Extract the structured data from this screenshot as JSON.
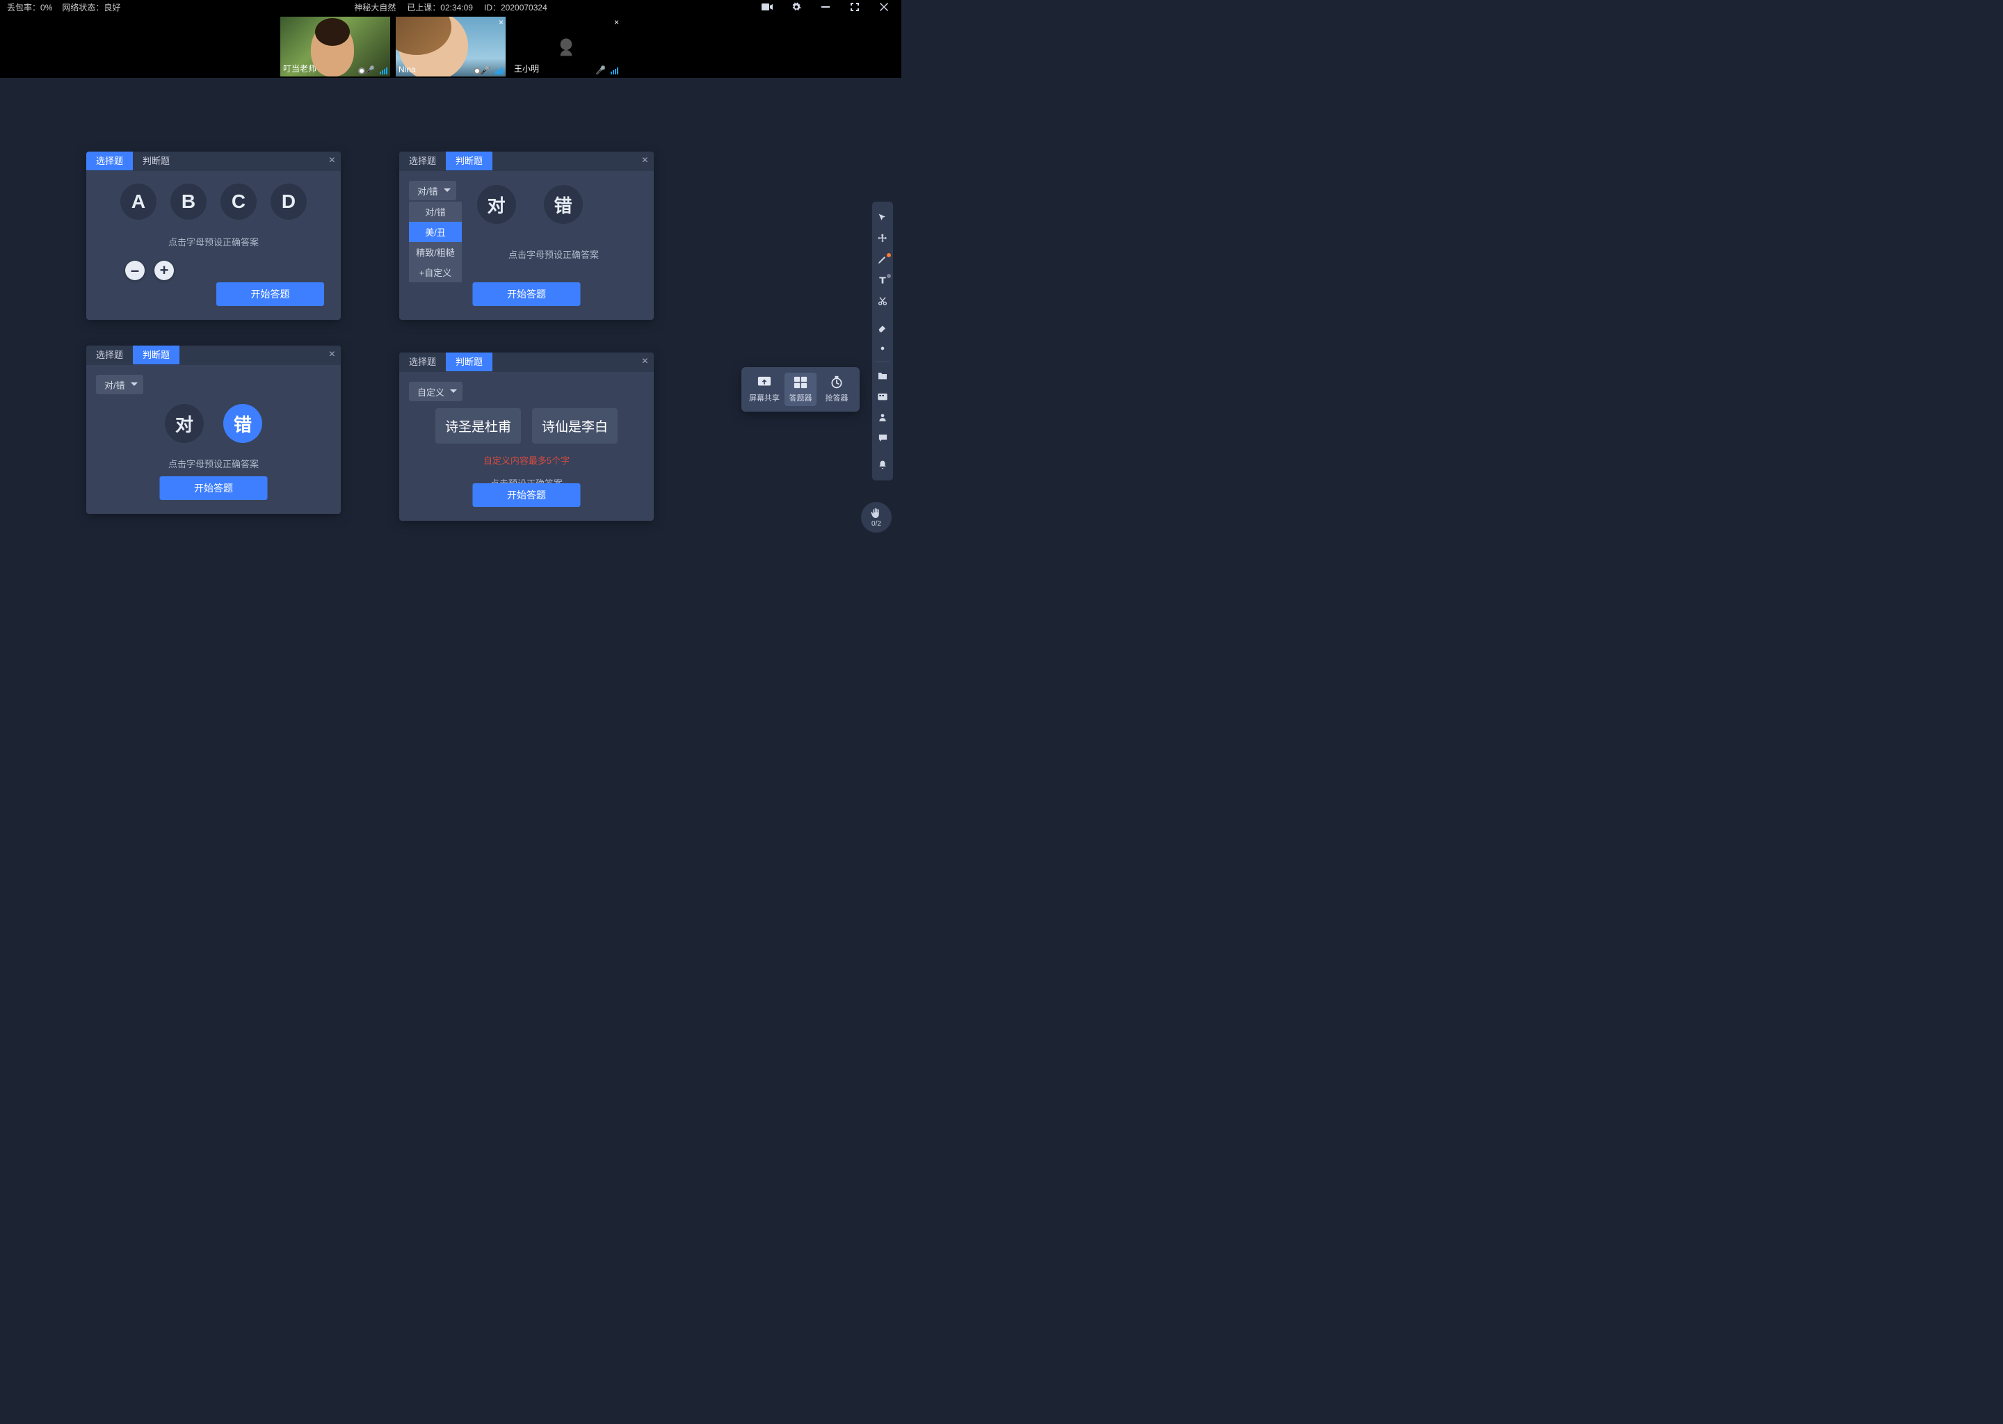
{
  "topbar": {
    "loss_label": "丢包率：",
    "loss_val": "0%",
    "net_label": "网络状态：",
    "net_val": "良好",
    "title": "神秘大自然",
    "status_label": "已上课：",
    "status_val": "02:34:09",
    "id_label": "ID：",
    "id_val": "2020070324"
  },
  "participants": [
    {
      "name": "叮当老师",
      "cam": true,
      "mic": true,
      "closeable": false
    },
    {
      "name": "Nina",
      "cam": true,
      "mic": true,
      "closeable": true
    },
    {
      "name": "王小明",
      "cam": false,
      "mic": false,
      "closeable": true
    }
  ],
  "common": {
    "tab_choice": "选择题",
    "tab_judge": "判断题",
    "preset_hint": "点击字母预设正确答案",
    "preset_hint2": "点击预设正确答案",
    "start": "开始答题",
    "minus": "–",
    "plus": "+"
  },
  "panel1": {
    "opts": [
      "A",
      "B",
      "C",
      "D"
    ]
  },
  "panel2": {
    "dd_sel": "对/错",
    "opts": [
      "对",
      "错"
    ],
    "menu": [
      "对/错",
      "美/丑",
      "精致/粗糙",
      "+自定义"
    ],
    "menu_sel": 1
  },
  "panel3": {
    "dd_sel": "对/错",
    "opts": [
      "对",
      "错"
    ],
    "sel": 1
  },
  "panel4": {
    "dd_sel": "自定义",
    "pills": [
      "诗圣是杜甫",
      "诗仙是李白"
    ],
    "err": "自定义内容最多5个字"
  },
  "tools": {
    "share": "屏幕共享",
    "answer": "答题器",
    "race": "抢答器"
  },
  "hand": "0/2"
}
